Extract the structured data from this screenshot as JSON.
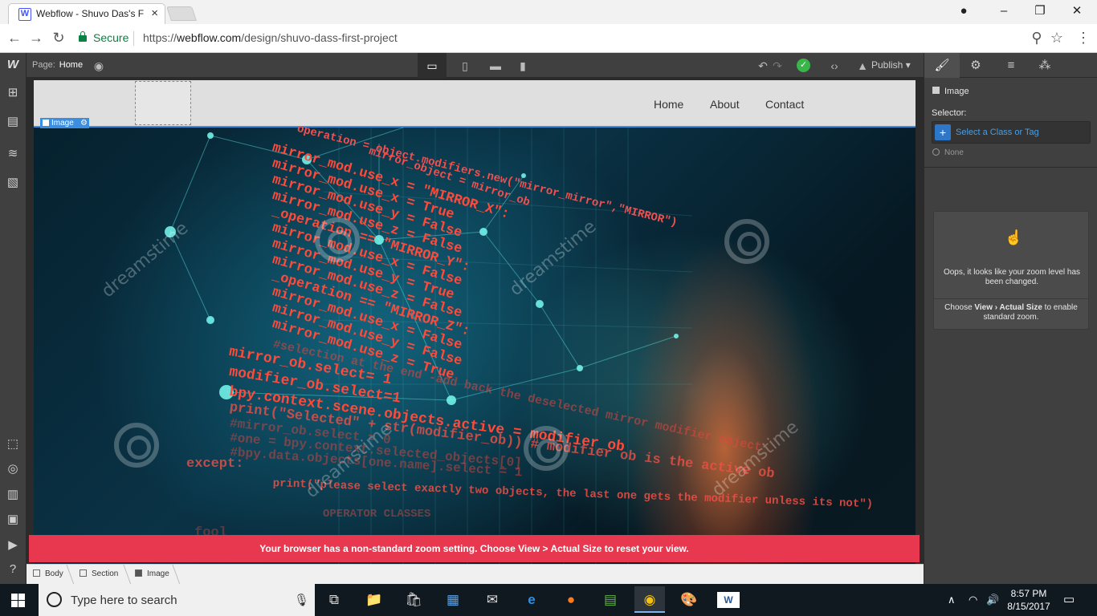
{
  "browser": {
    "tab_title": "Webflow - Shuvo Das's F",
    "tab_favicon": "W",
    "secure_label": "Secure",
    "url_prefix": "https://",
    "url_host": "webflow.com",
    "url_path": "/design/shuvo-dass-first-project"
  },
  "designer": {
    "page_label": "Page:",
    "page_name": "Home",
    "publish_label": "Publish",
    "right_panel": {
      "element_label": "Image",
      "selector_label": "Selector:",
      "selector_placeholder": "Select a Class or Tag",
      "selector_none": "None",
      "zoom_message": "Oops, it looks like your zoom level has been changed.",
      "zoom_tip_prefix": "Choose",
      "zoom_tip_bold": "View › Actual Size",
      "zoom_tip_suffix": "to enable standard zoom."
    },
    "canvas": {
      "selection_badge": "Image",
      "nav_links": [
        "Home",
        "About",
        "Contact"
      ],
      "watermark_text": "dreamstime",
      "zoom_banner": "Your browser has a non-standard zoom setting. Choose View > Actual Size to reset your view."
    },
    "breadcrumbs": [
      "Body",
      "Section",
      "Image"
    ]
  },
  "hero_code": [
    "operation = object.modifiers.new(\"mirror_mirror\",\"MIRROR\")",
    "mirror_object = mirror_ob",
    "mirror_mod.use_x = \"MIRROR_X\":",
    "mirror_mod.use_x = True",
    "mirror_mod.use_y = False",
    "mirror_mod.use_z = False",
    "_operation == \"MIRROR_Y\":",
    "mirror_mod.use_x = False",
    "mirror_mod.use_y = True",
    "mirror_mod.use_z = False",
    "_operation == \"MIRROR_Z\":",
    "mirror_mod.use_x = False",
    "mirror_mod.use_y = False",
    "mirror_mod.use_z = True",
    "#selection at the end -add back the deselected mirror modifier object",
    "mirror_ob.select= 1",
    "modifier_ob.select=1",
    "bpy.context.scene.objects.active = modifier_ob",
    "print(\"Selected\" + str(modifier_ob)) # modifier ob is the active ob",
    "#mirror_ob.select = 0",
    "#one = bpy.context.selected_objects[0]",
    "#bpy.data.objects[one.name].select = 1",
    "except:",
    "print(\"please select exactly two objects, the last one gets the modifier unless its not\")",
    "OPERATOR CLASSES",
    "fool"
  ],
  "taskbar": {
    "search_placeholder": "Type here to search",
    "time": "8:57 PM",
    "date": "8/15/2017"
  },
  "colors": {
    "chrome_bg": "#f2f2f2",
    "designer_bg": "#404040",
    "accent_blue": "#3b8ee0",
    "banner_red": "#e8384f",
    "secure_green": "#0b8043"
  }
}
